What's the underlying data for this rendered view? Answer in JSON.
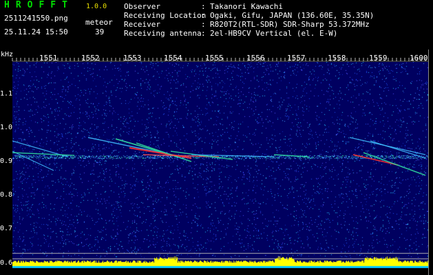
{
  "header": {
    "logo": "HROFFT",
    "version": "1.0.0",
    "filename": "2511241550.png",
    "timestamp": "25.11.24 15:50",
    "meteor_label": "meteor",
    "meteor_count": "39",
    "info": [
      {
        "label": "Observer",
        "value": "Takanori Kawachi"
      },
      {
        "label": "Receiving Location",
        "value": "Ogaki, Gifu, JAPAN (136.60E, 35.35N)"
      },
      {
        "label": "Receiver",
        "value": "R820T2(RTL-SDR) SDR-Sharp 53.372MHz"
      },
      {
        "label": "Receiving antenna",
        "value": "2el-HB9CV Vertical (el. E-W)"
      }
    ],
    "separator": ":"
  },
  "yaxis": {
    "unit": "kHz",
    "labels": [
      "1.1",
      "1.0",
      "0.9",
      "0.8",
      "0.7",
      "0.6"
    ],
    "values": [
      1.1,
      1.0,
      0.9,
      0.8,
      0.7,
      0.6
    ],
    "range": [
      0.585,
      1.195
    ]
  },
  "xaxis": {
    "labels": [
      "1551",
      "1552",
      "1553",
      "1554",
      "1555",
      "1556",
      "1557",
      "1558",
      "1559",
      "1600"
    ]
  },
  "colors": {
    "background": "#000060",
    "logo": "#00e000",
    "version": "#e8e000",
    "trace_core": "#ff3030",
    "trace_mid": "#00ff80",
    "trace_outer": "#40c0ff",
    "bottom_bar": "#ffff00",
    "bottom_bar_base": "#00c8ff"
  }
}
